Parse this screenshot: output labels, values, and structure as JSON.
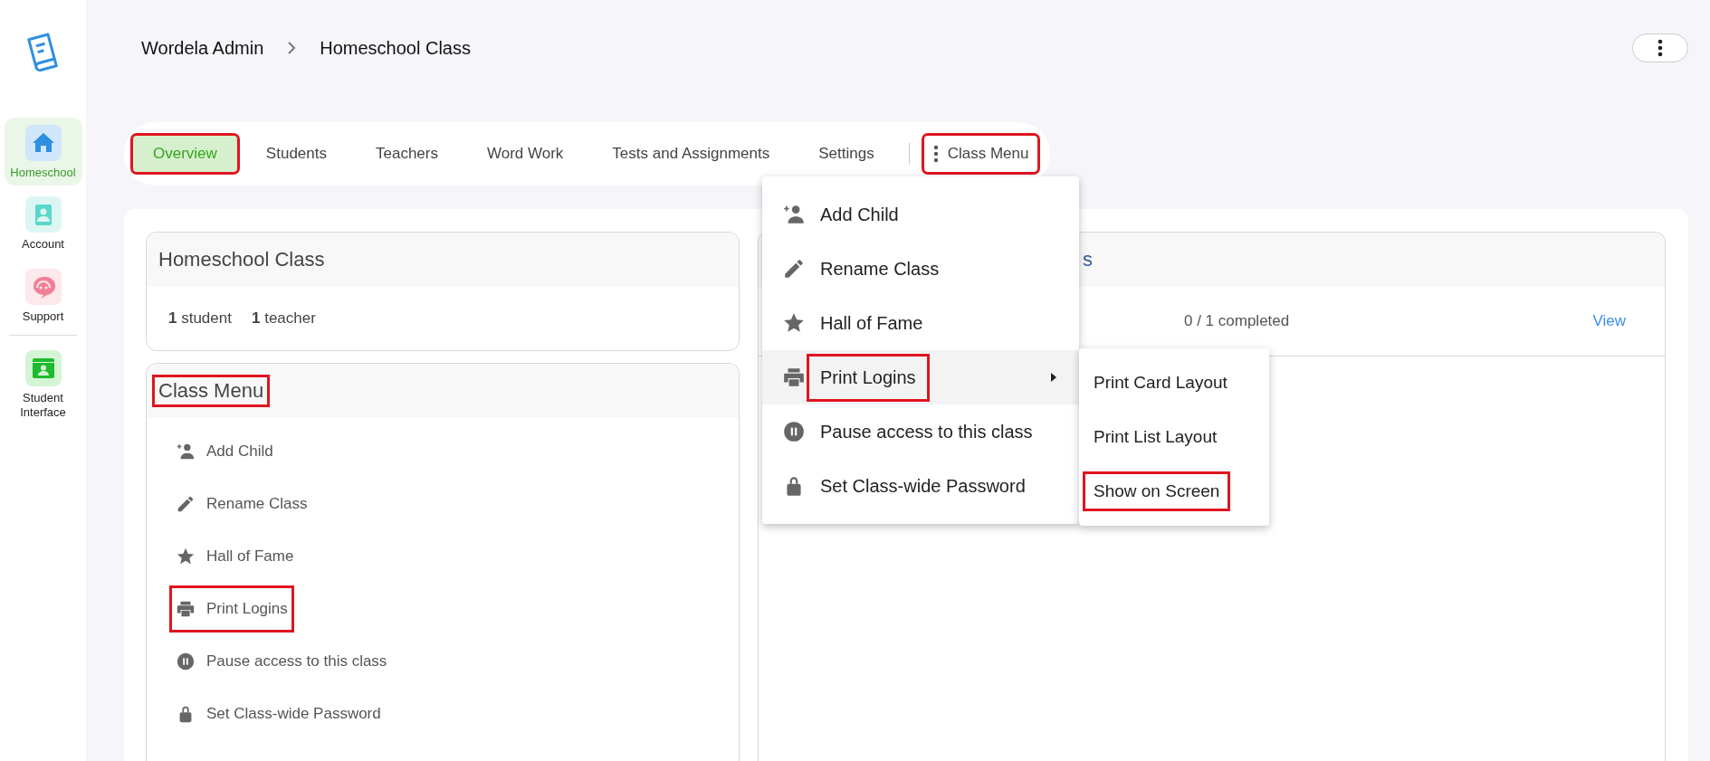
{
  "sidebar": {
    "items": [
      {
        "kind": "house",
        "label": "Homeschool",
        "selected": true
      },
      {
        "kind": "badge",
        "label": "Account",
        "selected": false
      },
      {
        "kind": "headset",
        "label": "Support",
        "selected": false
      },
      {
        "kind": "window",
        "label": "Student Interface",
        "selected": false
      }
    ]
  },
  "breadcrumb": [
    {
      "label": "Wordela Admin"
    },
    {
      "label": "Homeschool Class"
    }
  ],
  "tabs": [
    {
      "label": "Overview",
      "selected": true,
      "highlighted": true
    },
    {
      "label": "Students",
      "selected": false,
      "highlighted": false
    },
    {
      "label": "Teachers",
      "selected": false,
      "highlighted": false
    },
    {
      "label": "Word Work",
      "selected": false,
      "highlighted": false
    },
    {
      "label": "Tests and Assignments",
      "selected": false,
      "highlighted": false
    },
    {
      "label": "Settings",
      "selected": false,
      "highlighted": false
    }
  ],
  "class_menu_button": {
    "label": "Class Menu",
    "highlighted": true
  },
  "class_card": {
    "title": "Homeschool Class",
    "stats": [
      "**1** student",
      "**1** teacher"
    ]
  },
  "menu_card": {
    "title": "Class Menu",
    "title_highlighted": true,
    "items": [
      {
        "kind": "add-person",
        "label": "Add Child",
        "highlighted": false
      },
      {
        "kind": "pencil",
        "label": "Rename Class",
        "highlighted": false
      },
      {
        "kind": "star",
        "label": "Hall of Fame",
        "highlighted": false
      },
      {
        "kind": "printer",
        "label": "Print Logins",
        "highlighted": true
      },
      {
        "kind": "pause",
        "label": "Pause access to this class",
        "highlighted": false
      },
      {
        "kind": "lock",
        "label": "Set Class-wide Password",
        "highlighted": false
      }
    ]
  },
  "right_card": {
    "title": "s",
    "rows": [
      {
        "progress": "0 / 1 completed",
        "link": "View"
      }
    ]
  },
  "dropdown": {
    "items": [
      {
        "kind": "add-person",
        "label": "Add Child",
        "highlighted": false,
        "selected": false,
        "submenu": false
      },
      {
        "kind": "pencil",
        "label": "Rename Class",
        "highlighted": false,
        "selected": false,
        "submenu": false
      },
      {
        "kind": "star",
        "label": "Hall of Fame",
        "highlighted": false,
        "selected": false,
        "submenu": false
      },
      {
        "kind": "printer",
        "label": "Print Logins",
        "highlighted": true,
        "selected": true,
        "submenu": true
      },
      {
        "kind": "pause",
        "label": "Pause access to this class",
        "highlighted": false,
        "selected": false,
        "submenu": false
      },
      {
        "kind": "lock",
        "label": "Set Class-wide Password",
        "highlighted": false,
        "selected": false,
        "submenu": false
      }
    ]
  },
  "submenu": {
    "items": [
      {
        "label": "Print Card Layout",
        "highlighted": false
      },
      {
        "label": "Print List Layout",
        "highlighted": false
      },
      {
        "label": "Show on Screen",
        "highlighted": true
      }
    ]
  }
}
